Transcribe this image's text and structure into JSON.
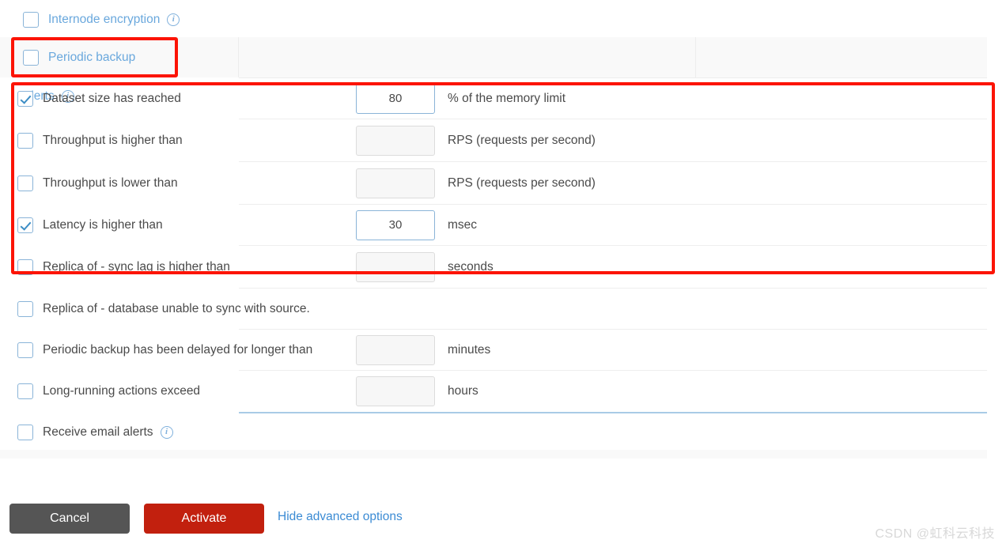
{
  "top_options": [
    {
      "label": "Internode encryption",
      "checked": false,
      "has_info": true
    },
    {
      "label": "Periodic backup",
      "checked": false,
      "has_info": false
    }
  ],
  "alerts_section": {
    "label": "Alerts",
    "has_info": true,
    "rows": [
      {
        "label": "Dataset size has reached",
        "checked": true,
        "value": "80",
        "unit": "% of the memory limit",
        "input_enabled": true
      },
      {
        "label": "Throughput is higher than",
        "checked": false,
        "value": "",
        "unit": "RPS (requests per second)",
        "input_enabled": false
      },
      {
        "label": "Throughput is lower than",
        "checked": false,
        "value": "",
        "unit": "RPS (requests per second)",
        "input_enabled": false
      },
      {
        "label": "Latency is higher than",
        "checked": true,
        "value": "30",
        "unit": "msec",
        "input_enabled": true
      },
      {
        "label": "Replica of - sync lag is higher than",
        "checked": false,
        "value": "",
        "unit": "seconds",
        "input_enabled": false
      },
      {
        "label": "Replica of - database unable to sync with source.",
        "checked": false,
        "value": null,
        "unit": "",
        "input_enabled": false
      },
      {
        "label": "Periodic backup has been delayed for longer than",
        "checked": false,
        "value": "",
        "unit": "minutes",
        "input_enabled": false
      },
      {
        "label": "Long-running actions exceed",
        "checked": false,
        "value": "",
        "unit": "hours",
        "input_enabled": false
      },
      {
        "label": "Receive email alerts",
        "checked": false,
        "value": null,
        "unit": "",
        "input_enabled": false,
        "has_info": true
      }
    ]
  },
  "footer": {
    "cancel_label": "Cancel",
    "activate_label": "Activate",
    "advanced_link_label": "Hide advanced options"
  },
  "watermark": "CSDN @虹科云科技",
  "colors": {
    "accent_blue": "#6aa8dd",
    "activate_red": "#c2200e",
    "cancel_gray": "#555555",
    "annotation_red": "#fc1405",
    "link_blue": "#3b8bd4"
  }
}
